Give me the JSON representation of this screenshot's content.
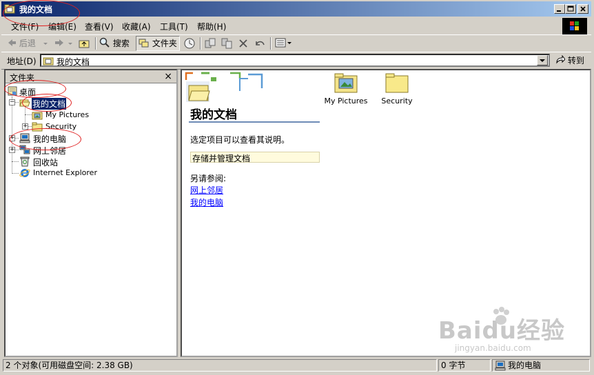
{
  "window": {
    "title": "我的文档",
    "buttons": [
      "minimize-button",
      "maximize-button",
      "close-button"
    ]
  },
  "menu": [
    {
      "label": "文件(F)"
    },
    {
      "label": "编辑(E)"
    },
    {
      "label": "查看(V)"
    },
    {
      "label": "收藏(A)"
    },
    {
      "label": "工具(T)"
    },
    {
      "label": "帮助(H)"
    }
  ],
  "toolbar": {
    "back_label": "后退",
    "search_label": "搜索",
    "folders_label": "文件夹"
  },
  "address": {
    "label": "地址(D)",
    "value": "我的文档",
    "go_label": "转到"
  },
  "folder_pane": {
    "title": "文件夹",
    "close": "×",
    "tree": [
      {
        "label": "桌面",
        "icon": "desktop-icon"
      },
      {
        "label": "我的文档",
        "icon": "open-folder-icon",
        "selected": true
      },
      {
        "label": "My Pictures",
        "icon": "pictures-folder-icon"
      },
      {
        "label": "Security",
        "icon": "folder-icon"
      },
      {
        "label": "我的电脑",
        "icon": "computer-icon"
      },
      {
        "label": "网上邻居",
        "icon": "network-icon"
      },
      {
        "label": "回收站",
        "icon": "recycle-bin-icon"
      },
      {
        "label": "Internet Explorer",
        "icon": "ie-icon"
      }
    ]
  },
  "content": {
    "heading": "我的文档",
    "hint": "选定项目可以查看其说明。",
    "tip": "存储并管理文档",
    "see_also": "另请参阅:",
    "links": [
      "网上邻居",
      "我的电脑"
    ],
    "items": [
      {
        "label": "My Pictures",
        "icon": "pictures-folder-icon"
      },
      {
        "label": "Security",
        "icon": "folder-icon"
      }
    ]
  },
  "status": {
    "objects": "2 个对象(可用磁盘空间: 2.38 GB)",
    "size": "0 字节",
    "location": "我的电脑"
  },
  "watermark": {
    "main": "Baidu经验",
    "sub": "jingyan.baidu.com"
  },
  "colors": {
    "title_start": "#0a246a",
    "title_end": "#a6caf0",
    "selection": "#0a246a",
    "link": "#0000ff",
    "annotation": "#e02020"
  }
}
